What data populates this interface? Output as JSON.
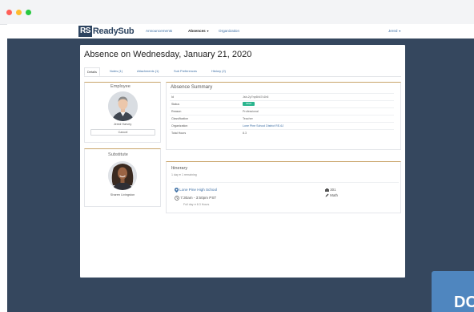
{
  "app": {
    "logo_mark": "RS",
    "logo_text": "ReadySub",
    "nav": {
      "announcements": "Announcements",
      "absences": "Absences",
      "organization": "Organization",
      "user": "Jered"
    }
  },
  "page": {
    "title": "Absence on Wednesday, January 21, 2020",
    "tabs": [
      {
        "label": "Details"
      },
      {
        "label": "Notes (1)"
      },
      {
        "label": "Attachments (1)"
      },
      {
        "label": "Sub Preferences"
      },
      {
        "label": "History (2)"
      }
    ]
  },
  "employee": {
    "title": "Employee",
    "name": "Jered Harvey",
    "cancel_label": "Cancel"
  },
  "substitute": {
    "title": "Substitute",
    "name": "Sharen Livingston"
  },
  "summary": {
    "title": "Absence Summary",
    "rows": [
      {
        "key": "Id",
        "value": "Jsb-2y7np6h47c1h6"
      },
      {
        "key": "Status",
        "value": "Filled"
      },
      {
        "key": "Reason",
        "value": "Professional"
      },
      {
        "key": "Classification",
        "value": "Teacher"
      },
      {
        "key": "Organization",
        "value": "Lone Pine School District RE-6J"
      },
      {
        "key": "Total Hours",
        "value": "8.3"
      }
    ]
  },
  "itinerary": {
    "title": "Itinerary",
    "day_count": "1 day",
    "remaining": "1 remaining",
    "location": "Lone Pine High School",
    "time": "7:30am - 3:50pm PST",
    "full_day": "Full day",
    "hours": "8.3 Hours",
    "room": "301",
    "subject": "Math"
  },
  "corner_text": "DC"
}
